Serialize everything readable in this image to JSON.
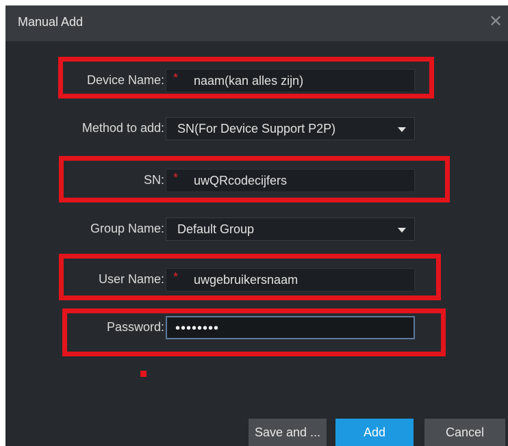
{
  "dialog": {
    "title": "Manual Add",
    "close_glyph": "✕"
  },
  "form": {
    "device_name": {
      "label": "Device Name:",
      "value": "naam(kan alles zijn)",
      "required_mark": "*"
    },
    "method_to_add": {
      "label": "Method to add:",
      "value": "SN(For Device Support P2P)"
    },
    "sn": {
      "label": "SN:",
      "value": "uwQRcodecijfers",
      "required_mark": "*"
    },
    "group_name": {
      "label": "Group Name:",
      "value": "Default Group"
    },
    "user_name": {
      "label": "User Name:",
      "value": "uwgebruikersnaam",
      "required_mark": "*"
    },
    "password": {
      "label": "Password:",
      "value": "••••••••"
    }
  },
  "buttons": {
    "save_and": "Save and ...",
    "add": "Add",
    "cancel": "Cancel"
  },
  "colors": {
    "highlight_red": "#e3141c",
    "add_button_blue": "#1c99e0",
    "dialog_background": "#262a2e"
  },
  "icons": {
    "close": "close-icon",
    "dropdown": "chevron-down-icon"
  }
}
